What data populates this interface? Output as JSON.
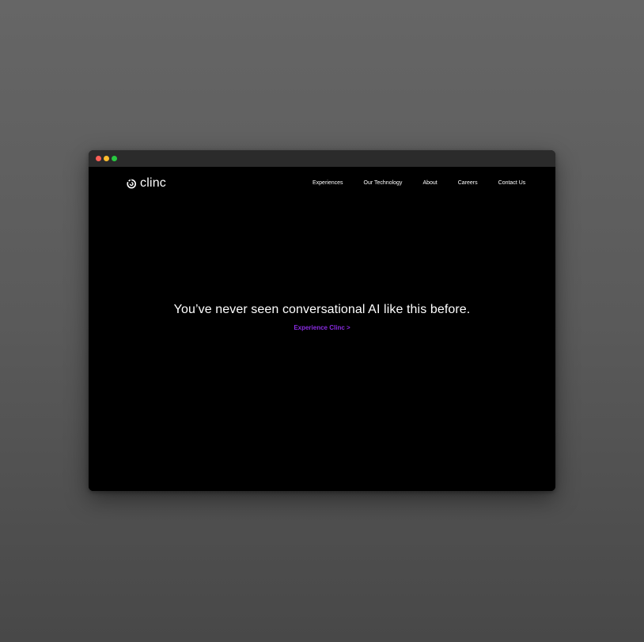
{
  "colors": {
    "background": "#5e5e5e",
    "window_bg": "#000000",
    "titlebar_bg": "#2b2b2b",
    "traffic_red": "#ff5f57",
    "traffic_yellow": "#ffbd2e",
    "traffic_green": "#28c940",
    "accent": "#8a2be2",
    "text": "#ffffff"
  },
  "brand": {
    "icon": "clinc-logo-icon",
    "name": "clinc"
  },
  "nav": {
    "items": [
      {
        "label": "Experiences"
      },
      {
        "label": "Our Technology"
      },
      {
        "label": "About"
      },
      {
        "label": "Careers"
      },
      {
        "label": "Contact Us"
      }
    ]
  },
  "hero": {
    "headline": "You’ve never seen conversational AI like this before.",
    "cta_label": "Experience Clinc >"
  }
}
